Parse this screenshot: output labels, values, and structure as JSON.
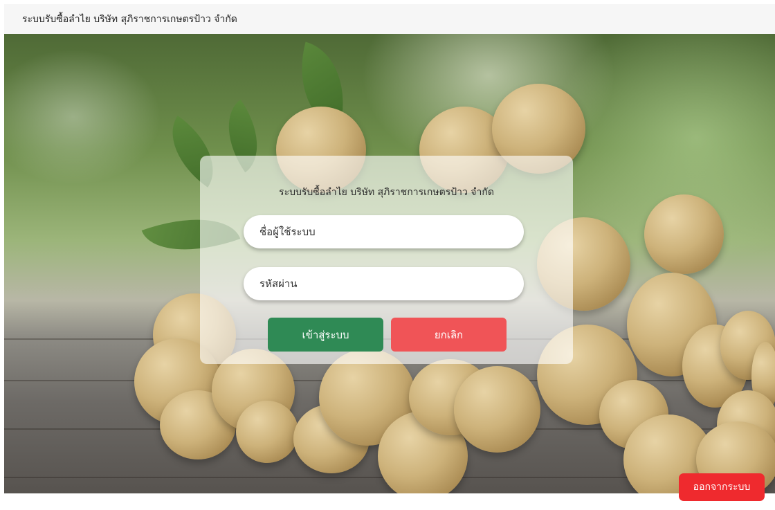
{
  "header": {
    "title": "ระบบรับซื้อลำไย บริษัท สุภิราชการเกษตรป้าว จำกัด"
  },
  "login": {
    "title": "ระบบรับซื้อลำไย บริษัท สุภิราชการเกษตรป้าว จำกัด",
    "username_placeholder": "ชื่อผู้ใช้ระบบ",
    "password_placeholder": "รหัสผ่าน",
    "login_label": "เข้าสู่ระบบ",
    "cancel_label": "ยกเลิก"
  },
  "logout_label": "ออกจากระบบ",
  "colors": {
    "login_button": "#2f8a55",
    "cancel_button": "#f05457",
    "logout_button": "#ef2a2e"
  }
}
